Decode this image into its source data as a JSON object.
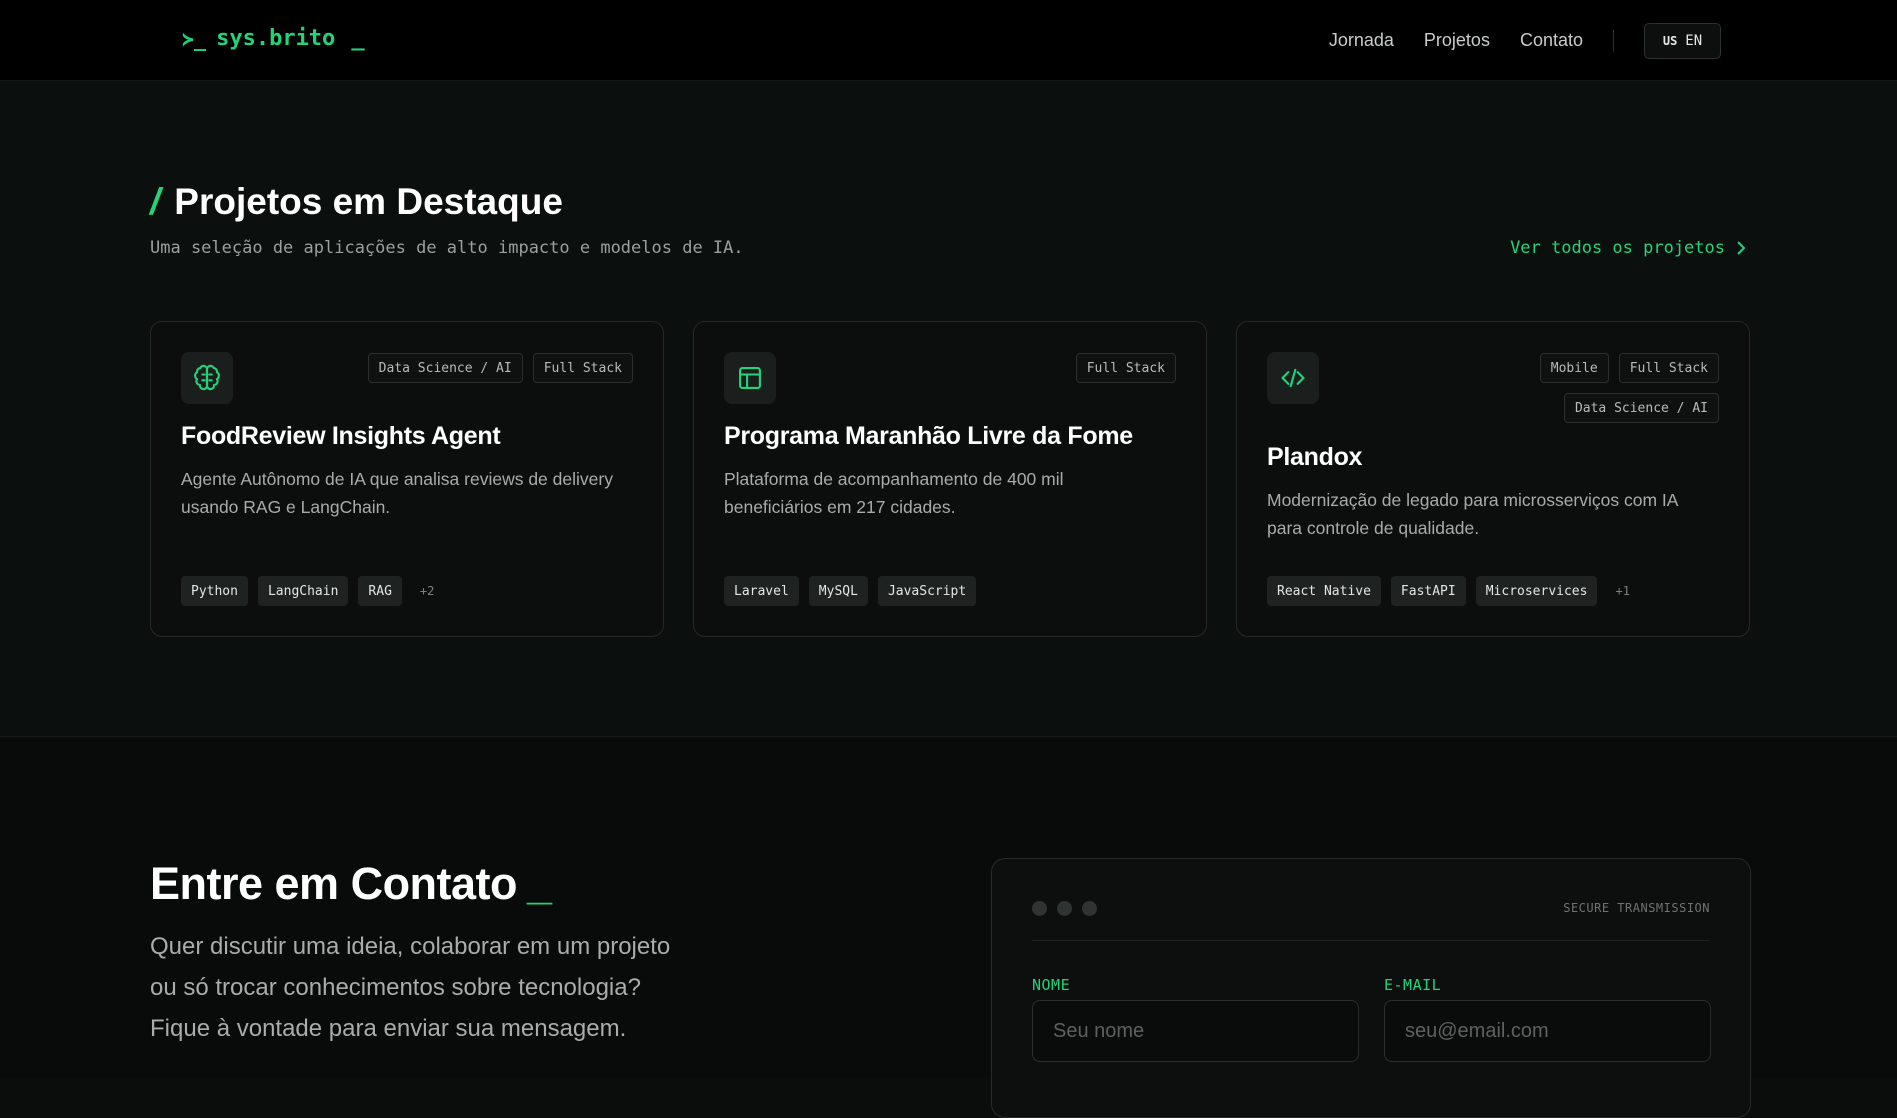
{
  "header": {
    "logo_prompt": "≻_",
    "logo_text": "sys.brito",
    "logo_cursor": "_",
    "nav": [
      "Jornada",
      "Projetos",
      "Contato"
    ],
    "lang_flag": "US",
    "lang_label": "EN"
  },
  "projects": {
    "title_slash": "/",
    "title": "Projetos em Destaque",
    "subtitle": "Uma seleção de aplicações de alto impacto e modelos de IA.",
    "see_all": "Ver todos os projetos",
    "cards": [
      {
        "icon": "brain-icon",
        "badges": [
          "Data Science / AI",
          "Full Stack"
        ],
        "title": "FoodReview Insights Agent",
        "desc_lines": [
          "Agente Autônomo de IA que analisa reviews de delivery",
          "usando RAG e LangChain."
        ],
        "techs": [
          "Python",
          "LangChain",
          "RAG"
        ],
        "more": "+2"
      },
      {
        "icon": "layout-icon",
        "badges": [
          "Full Stack"
        ],
        "title": "Programa Maranhão Livre da Fome",
        "desc_lines": [
          "Plataforma de acompanhamento de 400 mil",
          "beneficiários em 217 cidades."
        ],
        "techs": [
          "Laravel",
          "MySQL",
          "JavaScript"
        ],
        "more": ""
      },
      {
        "icon": "code-icon",
        "badges": [
          "Mobile",
          "Full Stack",
          "Data Science / AI"
        ],
        "title": "Plandox",
        "desc_lines": [
          "Modernização de legado para microsserviços com IA",
          "para controle de qualidade."
        ],
        "techs": [
          "React Native",
          "FastAPI",
          "Microservices"
        ],
        "more": "+1"
      }
    ]
  },
  "contact": {
    "title": "Entre em Contato",
    "title_cursor": "_",
    "text_lines": [
      "Quer discutir uma ideia, colaborar em um projeto",
      "ou só trocar conhecimentos sobre tecnologia?",
      "Fique à vontade para enviar sua mensagem."
    ],
    "secure_label": "SECURE TRANSMISSION",
    "name_label": "NOME",
    "name_placeholder": "Seu nome",
    "email_label": "E-MAIL",
    "email_placeholder": "seu@email.com"
  },
  "colors": {
    "accent": "#22d37a",
    "background": "#0b0f0e",
    "header": "#000000"
  }
}
